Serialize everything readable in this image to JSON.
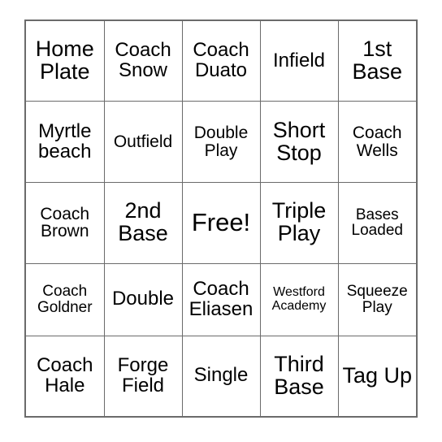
{
  "card": {
    "type": "bingo-card",
    "rows": 5,
    "columns": 5,
    "free_space": {
      "row": 3,
      "column": 3,
      "label": "Free!"
    },
    "border_color": "#6b6b6b",
    "text_color": "#000000",
    "background_color": "#ffffff",
    "cells": [
      [
        {
          "text": "Home Plate",
          "size": "s-lg"
        },
        {
          "text": "Coach Snow",
          "size": "s-md"
        },
        {
          "text": "Coach Duato",
          "size": "s-md"
        },
        {
          "text": "Infield",
          "size": "s-md"
        },
        {
          "text": "1st Base",
          "size": "s-lg"
        }
      ],
      [
        {
          "text": "Myrtle beach",
          "size": "s-md"
        },
        {
          "text": "Outfield",
          "size": "s-sm"
        },
        {
          "text": "Double Play",
          "size": "s-sm"
        },
        {
          "text": "Short Stop",
          "size": "s-lg"
        },
        {
          "text": "Coach Wells",
          "size": "s-sm"
        }
      ],
      [
        {
          "text": "Coach Brown",
          "size": "s-sm"
        },
        {
          "text": "2nd Base",
          "size": "s-lg"
        },
        {
          "text": "Free!",
          "size": "s-xl"
        },
        {
          "text": "Triple Play",
          "size": "s-lg"
        },
        {
          "text": "Bases Loaded",
          "size": "s-xs"
        }
      ],
      [
        {
          "text": "Coach Goldner",
          "size": "s-xs"
        },
        {
          "text": "Double",
          "size": "s-md"
        },
        {
          "text": "Coach Eliasen",
          "size": "s-md"
        },
        {
          "text": "Westford Academy",
          "size": "s-xxs"
        },
        {
          "text": "Squeeze Play",
          "size": "s-xs"
        }
      ],
      [
        {
          "text": "Coach Hale",
          "size": "s-md"
        },
        {
          "text": "Forge Field",
          "size": "s-md"
        },
        {
          "text": "Single",
          "size": "s-md"
        },
        {
          "text": "Third Base",
          "size": "s-lg"
        },
        {
          "text": "Tag Up",
          "size": "s-lg"
        }
      ]
    ]
  }
}
